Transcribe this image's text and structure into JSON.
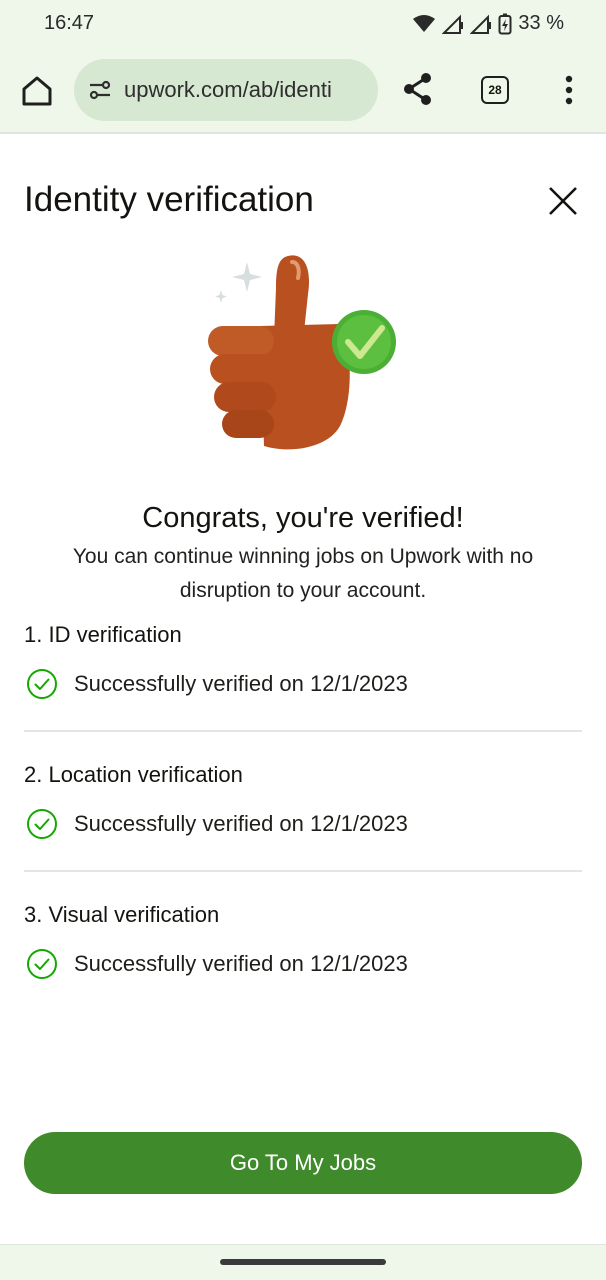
{
  "status_bar": {
    "time": "16:47",
    "battery": "33 %"
  },
  "browser": {
    "url": "upwork.com/ab/identi",
    "tab_count": "28",
    "icons": [
      "home-icon",
      "tune-icon",
      "share-icon",
      "tab-switcher-icon",
      "more-vert-icon"
    ]
  },
  "header": {
    "title": "Identity verification",
    "close_icon": "close-icon"
  },
  "hero": {
    "icon": "thumbs-up-check-illustration"
  },
  "congrats": {
    "title": "Congrats, you're verified!",
    "subtitle": "You can continue winning jobs on Upwork with no disruption to your account."
  },
  "steps": [
    {
      "title": "1. ID verification",
      "status": "Successfully verified on 12/1/2023",
      "icon": "check-circle-icon"
    },
    {
      "title": "2. Location verification",
      "status": "Successfully verified on 12/1/2023",
      "icon": "check-circle-icon"
    },
    {
      "title": "3. Visual verification",
      "status": "Successfully verified on 12/1/2023",
      "icon": "check-circle-icon"
    }
  ],
  "cta": {
    "label": "Go To My Jobs"
  },
  "colors": {
    "brand_green": "#3f8a2b",
    "check_green": "#14a800",
    "browser_chrome": "#eef7ea"
  }
}
